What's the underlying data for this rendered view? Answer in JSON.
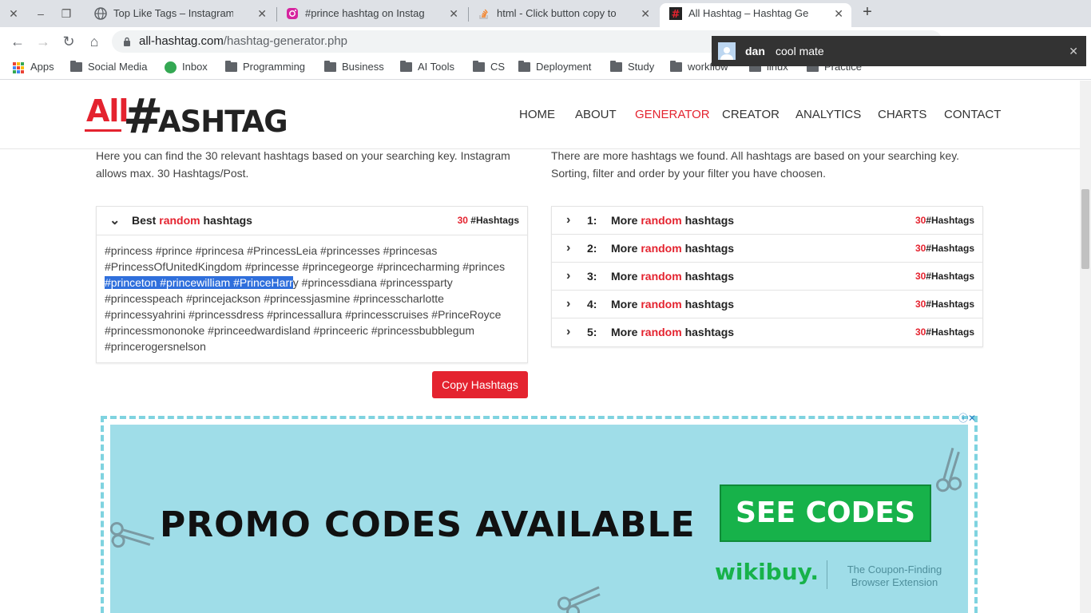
{
  "browser": {
    "tabs": [
      {
        "title": "Top Like Tags – Instagram H",
        "active": false,
        "favicon": "globe-icon"
      },
      {
        "title": "#prince hashtag on Instagra",
        "active": false,
        "favicon": "instagram-icon"
      },
      {
        "title": "html - Click button copy to",
        "active": false,
        "favicon": "stackoverflow-icon"
      },
      {
        "title": "All Hashtag – Hashtag Gene",
        "active": true,
        "favicon": "allhashtag-icon"
      }
    ],
    "url_host": "all-hashtag.com",
    "url_path": "/hashtag-generator.php",
    "bookmarks": [
      "Apps",
      "Social Media",
      "Inbox",
      "Programming",
      "Business",
      "AI Tools",
      "CS",
      "Deployment",
      "Study",
      "workflow",
      "linux",
      "Practice"
    ]
  },
  "notification": {
    "sender": "dan",
    "message": "cool mate"
  },
  "site": {
    "logo_all": "All",
    "logo_hash": "#",
    "logo_tag": "ASHTAG",
    "nav": [
      "HOME",
      "ABOUT",
      "GENERATOR",
      "CREATOR",
      "ANALYTICS",
      "CHARTS",
      "CONTACT"
    ],
    "active_nav": "GENERATOR"
  },
  "intro_left": "Here you can find the 30 relevant hashtags based on your searching key. Instagram allows max. 30 Hashtags/Post.",
  "intro_right": "There are more hashtags we found. All hashtags are based on your searching key. Sorting, filter and order by your filter you have choosen.",
  "best_panel": {
    "title_pre": "Best",
    "title_red": "random",
    "title_post": "hashtags",
    "count": "30",
    "count_label": "#Hashtags",
    "text_before": "#princess #prince #princesa #PrincessLeia #princesses #princesas #PrincessOfUnitedKingdom #princesse #princegeorge #princecharming #princes ",
    "text_selected": "#princeton #princewilliam #PrinceHarr",
    "text_after": "y #princessdiana #princessparty #princesspeach #princejackson #princessjasmine #princesscharlotte #princessyahrini #princessdress #princessallura #princesscruises #PrinceRoyce #princessmononoke #princeedwardisland #princeeric #princessbubblegum #princerogersnelson"
  },
  "more_panel": {
    "rows": [
      {
        "num": "1:",
        "pre": "More",
        "red": "random",
        "post": "hashtags",
        "count": "30",
        "count_label": "#Hashtags"
      },
      {
        "num": "2:",
        "pre": "More",
        "red": "random",
        "post": "hashtags",
        "count": "30",
        "count_label": "#Hashtags"
      },
      {
        "num": "3:",
        "pre": "More",
        "red": "random",
        "post": "hashtags",
        "count": "30",
        "count_label": "#Hashtags"
      },
      {
        "num": "4:",
        "pre": "More",
        "red": "random",
        "post": "hashtags",
        "count": "30",
        "count_label": "#Hashtags"
      },
      {
        "num": "5:",
        "pre": "More",
        "red": "random",
        "post": "hashtags",
        "count": "30",
        "count_label": "#Hashtags"
      }
    ]
  },
  "copy_button": "Copy Hashtags",
  "ad": {
    "headline": "PROMO CODES AVAILABLE",
    "cta": "SEE CODES",
    "brand": "wikibuy.",
    "tagline": "The Coupon-Finding Browser Extension"
  },
  "colors": {
    "accent": "#e4232f",
    "selection": "#2f6fdc",
    "ad_bg": "#9fdde8",
    "cta": "#17b24a"
  }
}
